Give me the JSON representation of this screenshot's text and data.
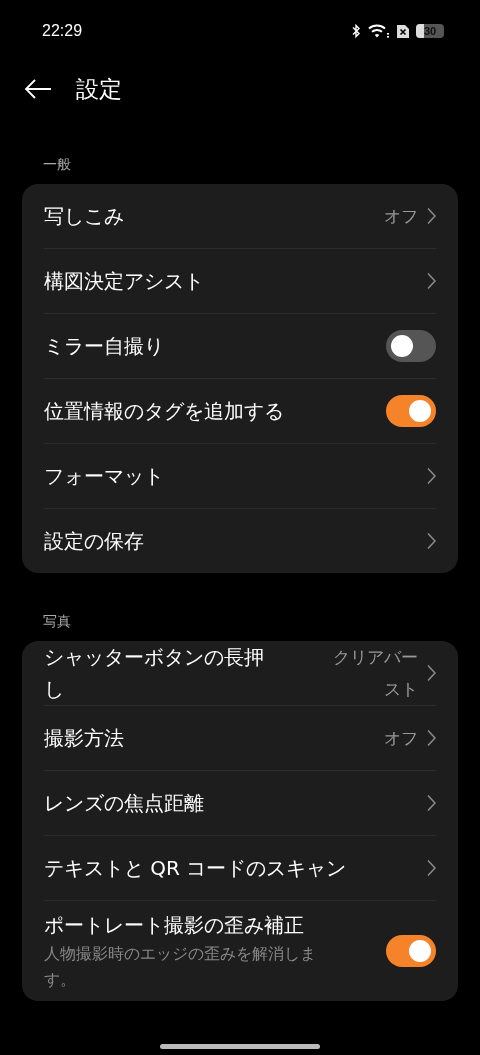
{
  "status_bar": {
    "time": "22:29",
    "battery": "30"
  },
  "header": {
    "title": "設定"
  },
  "sections": [
    {
      "label": "一般",
      "rows": [
        {
          "kind": "link",
          "title": "写しこみ",
          "value": "オフ"
        },
        {
          "kind": "link",
          "title": "構図決定アシスト"
        },
        {
          "kind": "toggle",
          "title": "ミラー自撮り",
          "on": false
        },
        {
          "kind": "toggle",
          "title": "位置情報のタグを追加する",
          "on": true
        },
        {
          "kind": "link",
          "title": "フォーマット"
        },
        {
          "kind": "link",
          "title": "設定の保存"
        }
      ]
    },
    {
      "label": "写真",
      "rows": [
        {
          "kind": "link",
          "title": "シャッターボタンの長押し",
          "value": "クリアバースト"
        },
        {
          "kind": "link",
          "title": "撮影方法",
          "value": "オフ"
        },
        {
          "kind": "link",
          "title": "レンズの焦点距離"
        },
        {
          "kind": "link",
          "title": "テキストと QR コードのスキャン"
        },
        {
          "kind": "toggle",
          "title": "ポートレート撮影の歪み補正",
          "description": "人物撮影時のエッジの歪みを解消します。",
          "on": true
        }
      ]
    }
  ]
}
